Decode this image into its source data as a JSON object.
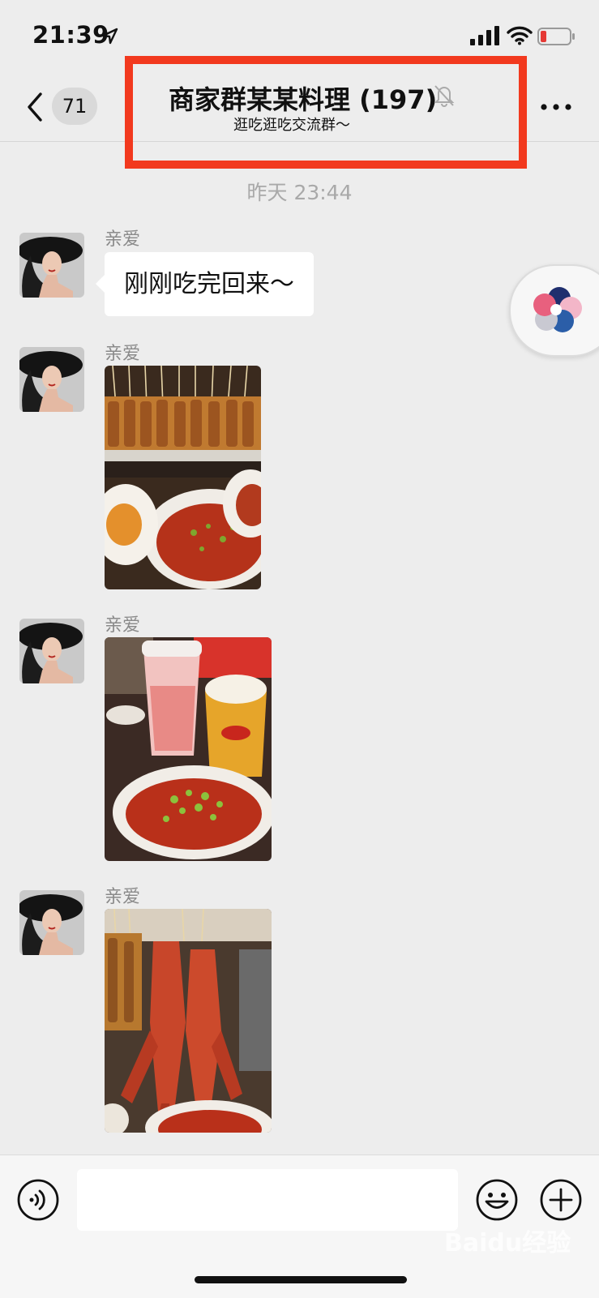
{
  "status_bar": {
    "time": "21:39",
    "icons": [
      "location-arrow-icon",
      "signal-bars-icon",
      "wifi-icon",
      "battery-low-icon"
    ],
    "battery_color": "#e53935"
  },
  "nav": {
    "unread_count": "71",
    "title": "商家群某某料理 (197)",
    "subtitle": "逛吃逛吃交流群～",
    "icons": [
      "back-chevron-icon",
      "mute-bell-icon",
      "more-dots-icon"
    ]
  },
  "highlight_color": "#f2391e",
  "chat": {
    "timestamp": "昨天 23:44",
    "messages": [
      {
        "sender": "亲爱",
        "type": "text",
        "text": "刚刚吃完回来～"
      },
      {
        "sender": "亲爱",
        "type": "image",
        "alt": "skewers-and-spicy-dishes-photo"
      },
      {
        "sender": "亲爱",
        "type": "image",
        "alt": "drinks-and-spicy-soup-photo"
      },
      {
        "sender": "亲爱",
        "type": "image",
        "alt": "crayfish-skewers-photo"
      }
    ]
  },
  "floating_widget": {
    "icon": "mini-program-flower-icon"
  },
  "input_bar": {
    "icons": [
      "voice-input-icon",
      "emoji-icon",
      "plus-icon"
    ],
    "message_value": ""
  },
  "watermark": "Baidu经验"
}
